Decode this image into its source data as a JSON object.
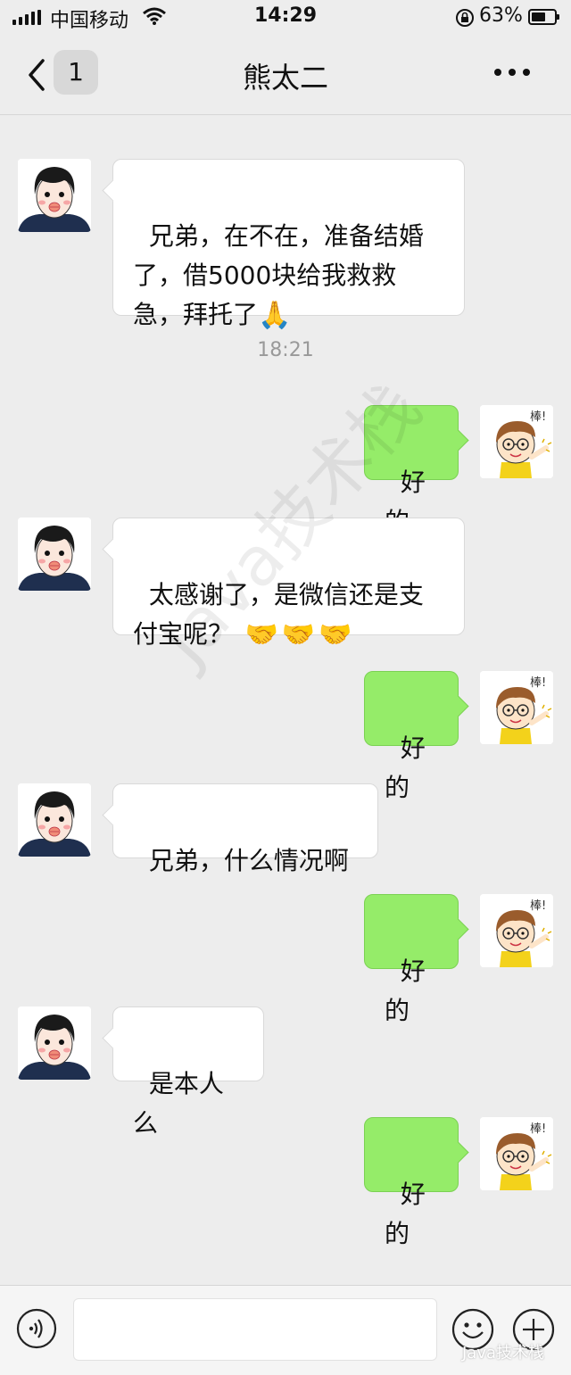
{
  "status_bar": {
    "carrier": "中国移动",
    "time": "14:29",
    "battery_percent": "63%",
    "battery_level": 0.63,
    "icons": [
      "signal-icon",
      "wifi-icon",
      "orientation-lock-icon",
      "battery-icon"
    ]
  },
  "nav": {
    "unread_count": "1",
    "title": "熊太二",
    "icons": [
      "back-chevron-icon",
      "more-dots-icon"
    ]
  },
  "messages": [
    {
      "from": "friend",
      "text": "兄弟，在不在，准备结婚\n了，借5000块给我救救\n急，拜托了",
      "emoji": "praying-hands"
    },
    {
      "from": "me",
      "text": "好的"
    },
    {
      "from": "friend",
      "text": "太感谢了，是微信还是支\n付宝呢？",
      "emoji": "handshake ×3"
    },
    {
      "from": "me",
      "text": "好的"
    },
    {
      "from": "friend",
      "text": "兄弟，什么情况啊"
    },
    {
      "from": "me",
      "text": "好的"
    },
    {
      "from": "friend",
      "text": "是本人么"
    },
    {
      "from": "me",
      "text": "好的"
    }
  ],
  "timestamp": "18:21",
  "sticker_text": "棒!",
  "watermark": "Java技术栈",
  "input_bar": {
    "placeholder": "",
    "icons": [
      "voice-icon",
      "emoji-icon",
      "plus-icon"
    ]
  },
  "colors": {
    "background": "#ededed",
    "outgoing_bubble": "#95ec69",
    "incoming_bubble": "#ffffff"
  }
}
